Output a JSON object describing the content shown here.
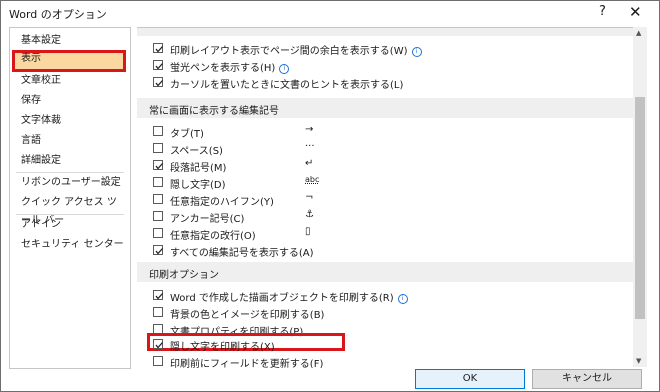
{
  "window": {
    "title": "Word のオプション",
    "help_label": "?",
    "close_label": "✕"
  },
  "sidebar": {
    "items": [
      {
        "label": "基本設定",
        "selected": false
      },
      {
        "label": "表示",
        "selected": true
      },
      {
        "label": "文章校正",
        "selected": false
      },
      {
        "label": "保存",
        "selected": false
      },
      {
        "label": "文字体裁",
        "selected": false
      },
      {
        "label": "言語",
        "selected": false
      },
      {
        "label": "詳細設定",
        "selected": false
      },
      {
        "label": "リボンのユーザー設定",
        "selected": false
      },
      {
        "label": "クイック アクセス ツール バー",
        "selected": false
      },
      {
        "label": "アドイン",
        "selected": false
      },
      {
        "label": "セキュリティ センター",
        "selected": false
      }
    ]
  },
  "page_options": {
    "items": [
      {
        "label": "印刷レイアウト表示でページ間の余白を表示する(W)",
        "checked": true,
        "info": true
      },
      {
        "label": "蛍光ペンを表示する(H)",
        "checked": true,
        "info": true
      },
      {
        "label": "カーソルを置いたときに文書のヒントを表示する(L)",
        "checked": true,
        "info": false
      }
    ]
  },
  "formatting_marks": {
    "header": "常に画面に表示する編集記号",
    "items": [
      {
        "label": "タブ(T)",
        "checked": false,
        "symbol": "→"
      },
      {
        "label": "スペース(S)",
        "checked": false,
        "symbol": "···"
      },
      {
        "label": "段落記号(M)",
        "checked": true,
        "symbol": "↵"
      },
      {
        "label": "隠し文字(D)",
        "checked": false,
        "symbol": "abc"
      },
      {
        "label": "任意指定のハイフン(Y)",
        "checked": false,
        "symbol": "¬"
      },
      {
        "label": "アンカー記号(C)",
        "checked": false,
        "symbol": "⚓"
      },
      {
        "label": "任意指定の改行(O)",
        "checked": false,
        "symbol": "▯"
      },
      {
        "label": "すべての編集記号を表示する(A)",
        "checked": true,
        "symbol": ""
      }
    ]
  },
  "print_options": {
    "header": "印刷オプション",
    "items": [
      {
        "label": "Word で作成した描画オブジェクトを印刷する(R)",
        "checked": true,
        "info": true
      },
      {
        "label": "背景の色とイメージを印刷する(B)",
        "checked": false,
        "info": false
      },
      {
        "label": "文書プロパティを印刷する(P)",
        "checked": false,
        "info": false
      },
      {
        "label": "隠し文字を印刷する(X)",
        "checked": true,
        "info": false
      },
      {
        "label": "印刷前にフィールドを更新する(F)",
        "checked": false,
        "info": false
      }
    ]
  },
  "buttons": {
    "ok": "OK",
    "cancel": "キャンセル"
  },
  "colors": {
    "highlight_border": "#d9161a",
    "selected_bg": "#fbd8a0",
    "section_bg": "#efefef"
  }
}
